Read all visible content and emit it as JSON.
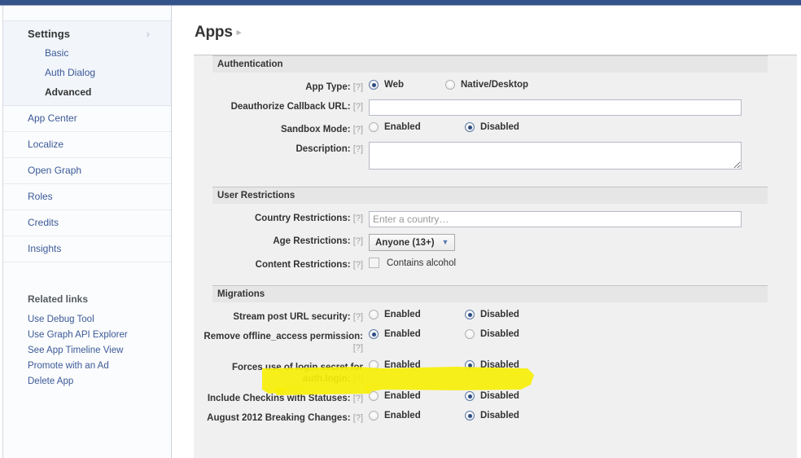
{
  "window": {
    "accent_color": "#33538a",
    "panel_bg": "#f0f0f0",
    "section_header_bg": "#e6e6e6",
    "link_color": "#3b5998",
    "highlight_color": "#f7ef07"
  },
  "sidebar": {
    "settings": {
      "label": "Settings",
      "arrow_icon": "chevron-right-icon",
      "sub_items": [
        {
          "label": "Basic",
          "active": false
        },
        {
          "label": "Auth Dialog",
          "active": false
        },
        {
          "label": "Advanced",
          "active": true
        }
      ]
    },
    "items": [
      {
        "label": "App Center"
      },
      {
        "label": "Localize"
      },
      {
        "label": "Open Graph"
      },
      {
        "label": "Roles"
      },
      {
        "label": "Credits"
      },
      {
        "label": "Insights"
      }
    ],
    "related": {
      "title": "Related links",
      "links": [
        {
          "label": "Use Debug Tool"
        },
        {
          "label": "Use Graph API Explorer"
        },
        {
          "label": "See App Timeline View"
        },
        {
          "label": "Promote with an Ad"
        },
        {
          "label": "Delete App"
        }
      ]
    }
  },
  "main": {
    "title": "Apps",
    "title_caret": "▸",
    "help_marker": "[?]",
    "sections": [
      {
        "id": "authentication",
        "header": "Authentication",
        "rows": [
          {
            "id": "app-type",
            "label": "App Type:",
            "type": "radio",
            "options": [
              {
                "label": "Web",
                "selected": true
              },
              {
                "label": "Native/Desktop",
                "selected": false
              }
            ]
          },
          {
            "id": "deauthorize-callback-url",
            "label": "Deauthorize Callback URL:",
            "type": "text",
            "value": "",
            "placeholder": ""
          },
          {
            "id": "sandbox-mode",
            "label": "Sandbox Mode:",
            "type": "radio",
            "options": [
              {
                "label": "Enabled",
                "selected": false
              },
              {
                "label": "Disabled",
                "selected": true
              }
            ]
          },
          {
            "id": "description",
            "label": "Description:",
            "type": "textarea",
            "value": "",
            "placeholder": ""
          }
        ]
      },
      {
        "id": "user-restrictions",
        "header": "User Restrictions",
        "rows": [
          {
            "id": "country-restrictions",
            "label": "Country Restrictions:",
            "type": "text",
            "value": "",
            "placeholder": "Enter a country…"
          },
          {
            "id": "age-restrictions",
            "label": "Age Restrictions:",
            "type": "select",
            "value": "Anyone (13+)",
            "caret_icon": "chevron-down-icon",
            "options": [
              "Anyone (13+)"
            ]
          },
          {
            "id": "content-restrictions",
            "label": "Content Restrictions:",
            "type": "checkbox",
            "checkbox_label": "Contains alcohol",
            "checked": false
          }
        ]
      },
      {
        "id": "migrations",
        "header": "Migrations",
        "rows": [
          {
            "id": "stream-post-url-security",
            "label": "Stream post URL security:",
            "type": "radio",
            "options": [
              {
                "label": "Enabled",
                "selected": false
              },
              {
                "label": "Disabled",
                "selected": true
              }
            ]
          },
          {
            "id": "remove-offline-access-permission",
            "label": "Remove offline_access permission:",
            "type": "radio",
            "highlighted": true,
            "options": [
              {
                "label": "Enabled",
                "selected": true
              },
              {
                "label": "Disabled",
                "selected": false
              }
            ]
          },
          {
            "id": "forces-use-of-login-secret",
            "label": "Forces use of login secret for auth.login:",
            "type": "radio",
            "options": [
              {
                "label": "Enabled",
                "selected": false
              },
              {
                "label": "Disabled",
                "selected": true
              }
            ]
          },
          {
            "id": "include-checkins-with-statuses",
            "label": "Include Checkins with Statuses:",
            "type": "radio",
            "options": [
              {
                "label": "Enabled",
                "selected": false
              },
              {
                "label": "Disabled",
                "selected": true
              }
            ]
          },
          {
            "id": "august-2012-breaking-changes",
            "label": "August 2012 Breaking Changes:",
            "type": "radio",
            "options": [
              {
                "label": "Enabled",
                "selected": false
              },
              {
                "label": "Disabled",
                "selected": true
              }
            ]
          }
        ]
      }
    ]
  }
}
